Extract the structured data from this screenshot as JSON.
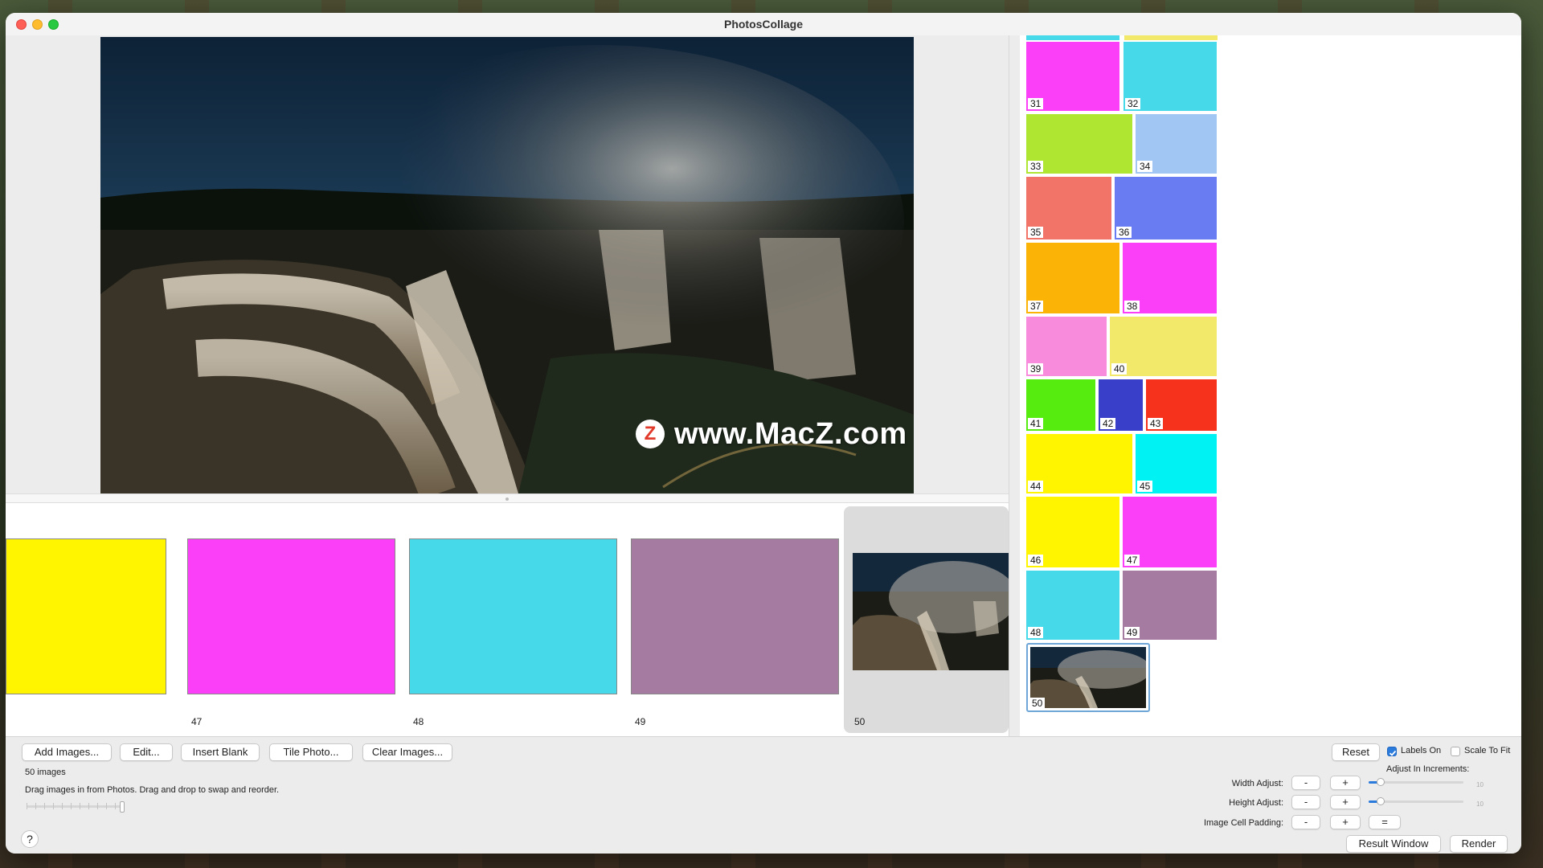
{
  "window": {
    "title": "PhotosCollage"
  },
  "preview": {
    "watermark": "www.MacZ.com",
    "watermark_badge": "Z"
  },
  "strip": {
    "cells": [
      {
        "label": "",
        "color": "#fff500"
      },
      {
        "label": "47",
        "color": "#fb3ef8"
      },
      {
        "label": "48",
        "color": "#45d9ea"
      },
      {
        "label": "49",
        "color": "#a57ba1"
      },
      {
        "label": "50",
        "color": "photo"
      }
    ]
  },
  "grid": {
    "tiles": [
      {
        "label": "31",
        "color": "#fb3ef8"
      },
      {
        "label": "32",
        "color": "#45d9ea"
      },
      {
        "label": "33",
        "color": "#aee631"
      },
      {
        "label": "34",
        "color": "#a2c6f4"
      },
      {
        "label": "35",
        "color": "#f27468"
      },
      {
        "label": "36",
        "color": "#6a7cf2"
      },
      {
        "label": "37",
        "color": "#fbb406"
      },
      {
        "label": "38",
        "color": "#fb3ef8"
      },
      {
        "label": "39",
        "color": "#f98bdc"
      },
      {
        "label": "40",
        "color": "#f2e96a"
      },
      {
        "label": "41",
        "color": "#57ec10"
      },
      {
        "label": "42",
        "color": "#3a3fca"
      },
      {
        "label": "43",
        "color": "#f6311c"
      },
      {
        "label": "44",
        "color": "#fff500"
      },
      {
        "label": "45",
        "color": "#00f2f2"
      },
      {
        "label": "46",
        "color": "#fff500"
      },
      {
        "label": "47",
        "color": "#fb3ef8"
      },
      {
        "label": "48",
        "color": "#45d9ea"
      },
      {
        "label": "49",
        "color": "#a57ba1"
      },
      {
        "label": "50",
        "color": "photo"
      }
    ]
  },
  "toolbar": {
    "add_images": "Add Images...",
    "edit": "Edit...",
    "insert_blank": "Insert Blank",
    "tile_photo": "Tile Photo...",
    "clear_images": "Clear Images...",
    "image_count": "50 images",
    "hint": "Drag images in from Photos. Drag and drop to swap and reorder.",
    "help": "?"
  },
  "controls": {
    "reset": "Reset",
    "labels_on": "Labels On",
    "labels_on_checked": true,
    "scale_to_fit": "Scale To Fit",
    "scale_to_fit_checked": false,
    "adjust_in_increments": "Adjust In Increments:",
    "width_adjust": "Width Adjust:",
    "height_adjust": "Height Adjust:",
    "image_cell_padding": "Image Cell Padding:",
    "minus": "-",
    "plus": "+",
    "equals": "=",
    "slider_max": "10",
    "result_window": "Result Window",
    "render": "Render"
  }
}
